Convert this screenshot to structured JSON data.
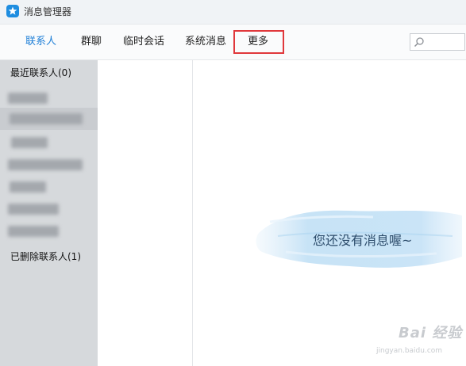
{
  "window": {
    "title": "消息管理器"
  },
  "tabs": [
    {
      "label": "联系人",
      "active": true
    },
    {
      "label": "群聊",
      "active": false
    },
    {
      "label": "临时会话",
      "active": false
    },
    {
      "label": "系统消息",
      "active": false
    },
    {
      "label": "更多",
      "active": false,
      "highlighted": true
    }
  ],
  "search": {
    "placeholder": "",
    "value": ""
  },
  "sidebar": {
    "recent_header": "最近联系人(0)",
    "deleted_header": "已删除联系人(1)",
    "contacts_count_blurred": 7
  },
  "main": {
    "empty_message": "您还没有消息喔~"
  },
  "watermark": {
    "brand": "Bai 经验",
    "url": "jingyan.baidu.com"
  },
  "colors": {
    "accent": "#1e7fd7",
    "highlight_box": "#e0383c",
    "sidebar_bg": "#d6d9dc"
  }
}
